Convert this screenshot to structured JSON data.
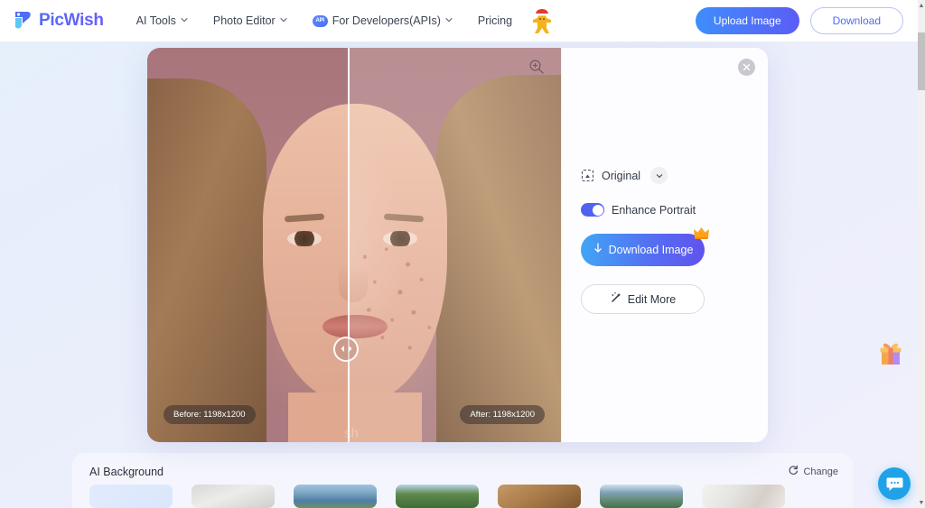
{
  "app": {
    "brand_name": "PicWish",
    "brand_icon": "picwish-logo-icon"
  },
  "nav": {
    "items": [
      {
        "label": "AI Tools",
        "has_chevron": true,
        "icon": null
      },
      {
        "label": "Photo Editor",
        "has_chevron": true,
        "icon": null
      },
      {
        "label": "For Developers(APIs)",
        "has_chevron": true,
        "icon": "api-cloud-icon",
        "icon_text": "API"
      },
      {
        "label": "Pricing",
        "has_chevron": false,
        "icon": null
      }
    ],
    "mascot": "gingerbread-santa-icon",
    "upload_label": "Upload Image",
    "download_label": "Download"
  },
  "editor": {
    "zoom_icon": "zoom-in-icon",
    "close_icon": "close-icon",
    "slider_icon": "left-right-arrows-icon",
    "before_tag": "Before: 1198x1200",
    "after_tag": "After: 1198x1200",
    "watermark": "sh\nter download"
  },
  "controls": {
    "ratio_icon": "crop-original-icon",
    "ratio_label": "Original",
    "ratio_chevron": "chevron-down-icon",
    "toggle_label": "Enhance Portrait",
    "toggle_on": true,
    "download_label": "Download Image",
    "download_icon": "download-arrow-icon",
    "premium_badge": "crown-icon",
    "edit_more_label": "Edit More",
    "edit_more_icon": "magic-wand-icon"
  },
  "background_panel": {
    "title": "AI Background",
    "change_label": "Change",
    "change_icon": "refresh-icon",
    "thumbnails": [
      {
        "name": "plain-blue-gradient",
        "css": "linear-gradient(135deg,#e2ebfc 0%,#dbe6fb 100%)"
      },
      {
        "name": "white-studio-wall",
        "css": "linear-gradient(160deg,#d8d8d6 0%,#ececeb 45%,#cfcfcd 100%)"
      },
      {
        "name": "city-skyline",
        "css": "linear-gradient(180deg,#9fc4dd 0%,#7ea6c4 35%,#4f7fa5 70%,#6f8f62 100%)"
      },
      {
        "name": "green-park-trees",
        "css": "linear-gradient(180deg,#b9d6e8 0%,#5f8a4d 40%,#3f6b37 100%)"
      },
      {
        "name": "wooden-interior",
        "css": "linear-gradient(150deg,#c49a66 0%,#a87a48 50%,#7e5730 100%)"
      },
      {
        "name": "mountain-landscape",
        "css": "linear-gradient(180deg,#cfe2ee 0%,#7fa0b4 35%,#5f8a6e 70%,#46704d 100%)"
      },
      {
        "name": "bright-window-room",
        "css": "linear-gradient(120deg,#f2f2f0 0%,#e3e3e0 40%,#d6cfc8 70%,#ebe8e4 100%)"
      }
    ]
  },
  "widgets": {
    "gift_icon": "gift-box-icon",
    "chat_icon": "chat-bubble-icon"
  },
  "scrollbar": {
    "up_arrow": "scroll-up-arrow-icon",
    "down_arrow": "scroll-down-arrow-icon"
  }
}
